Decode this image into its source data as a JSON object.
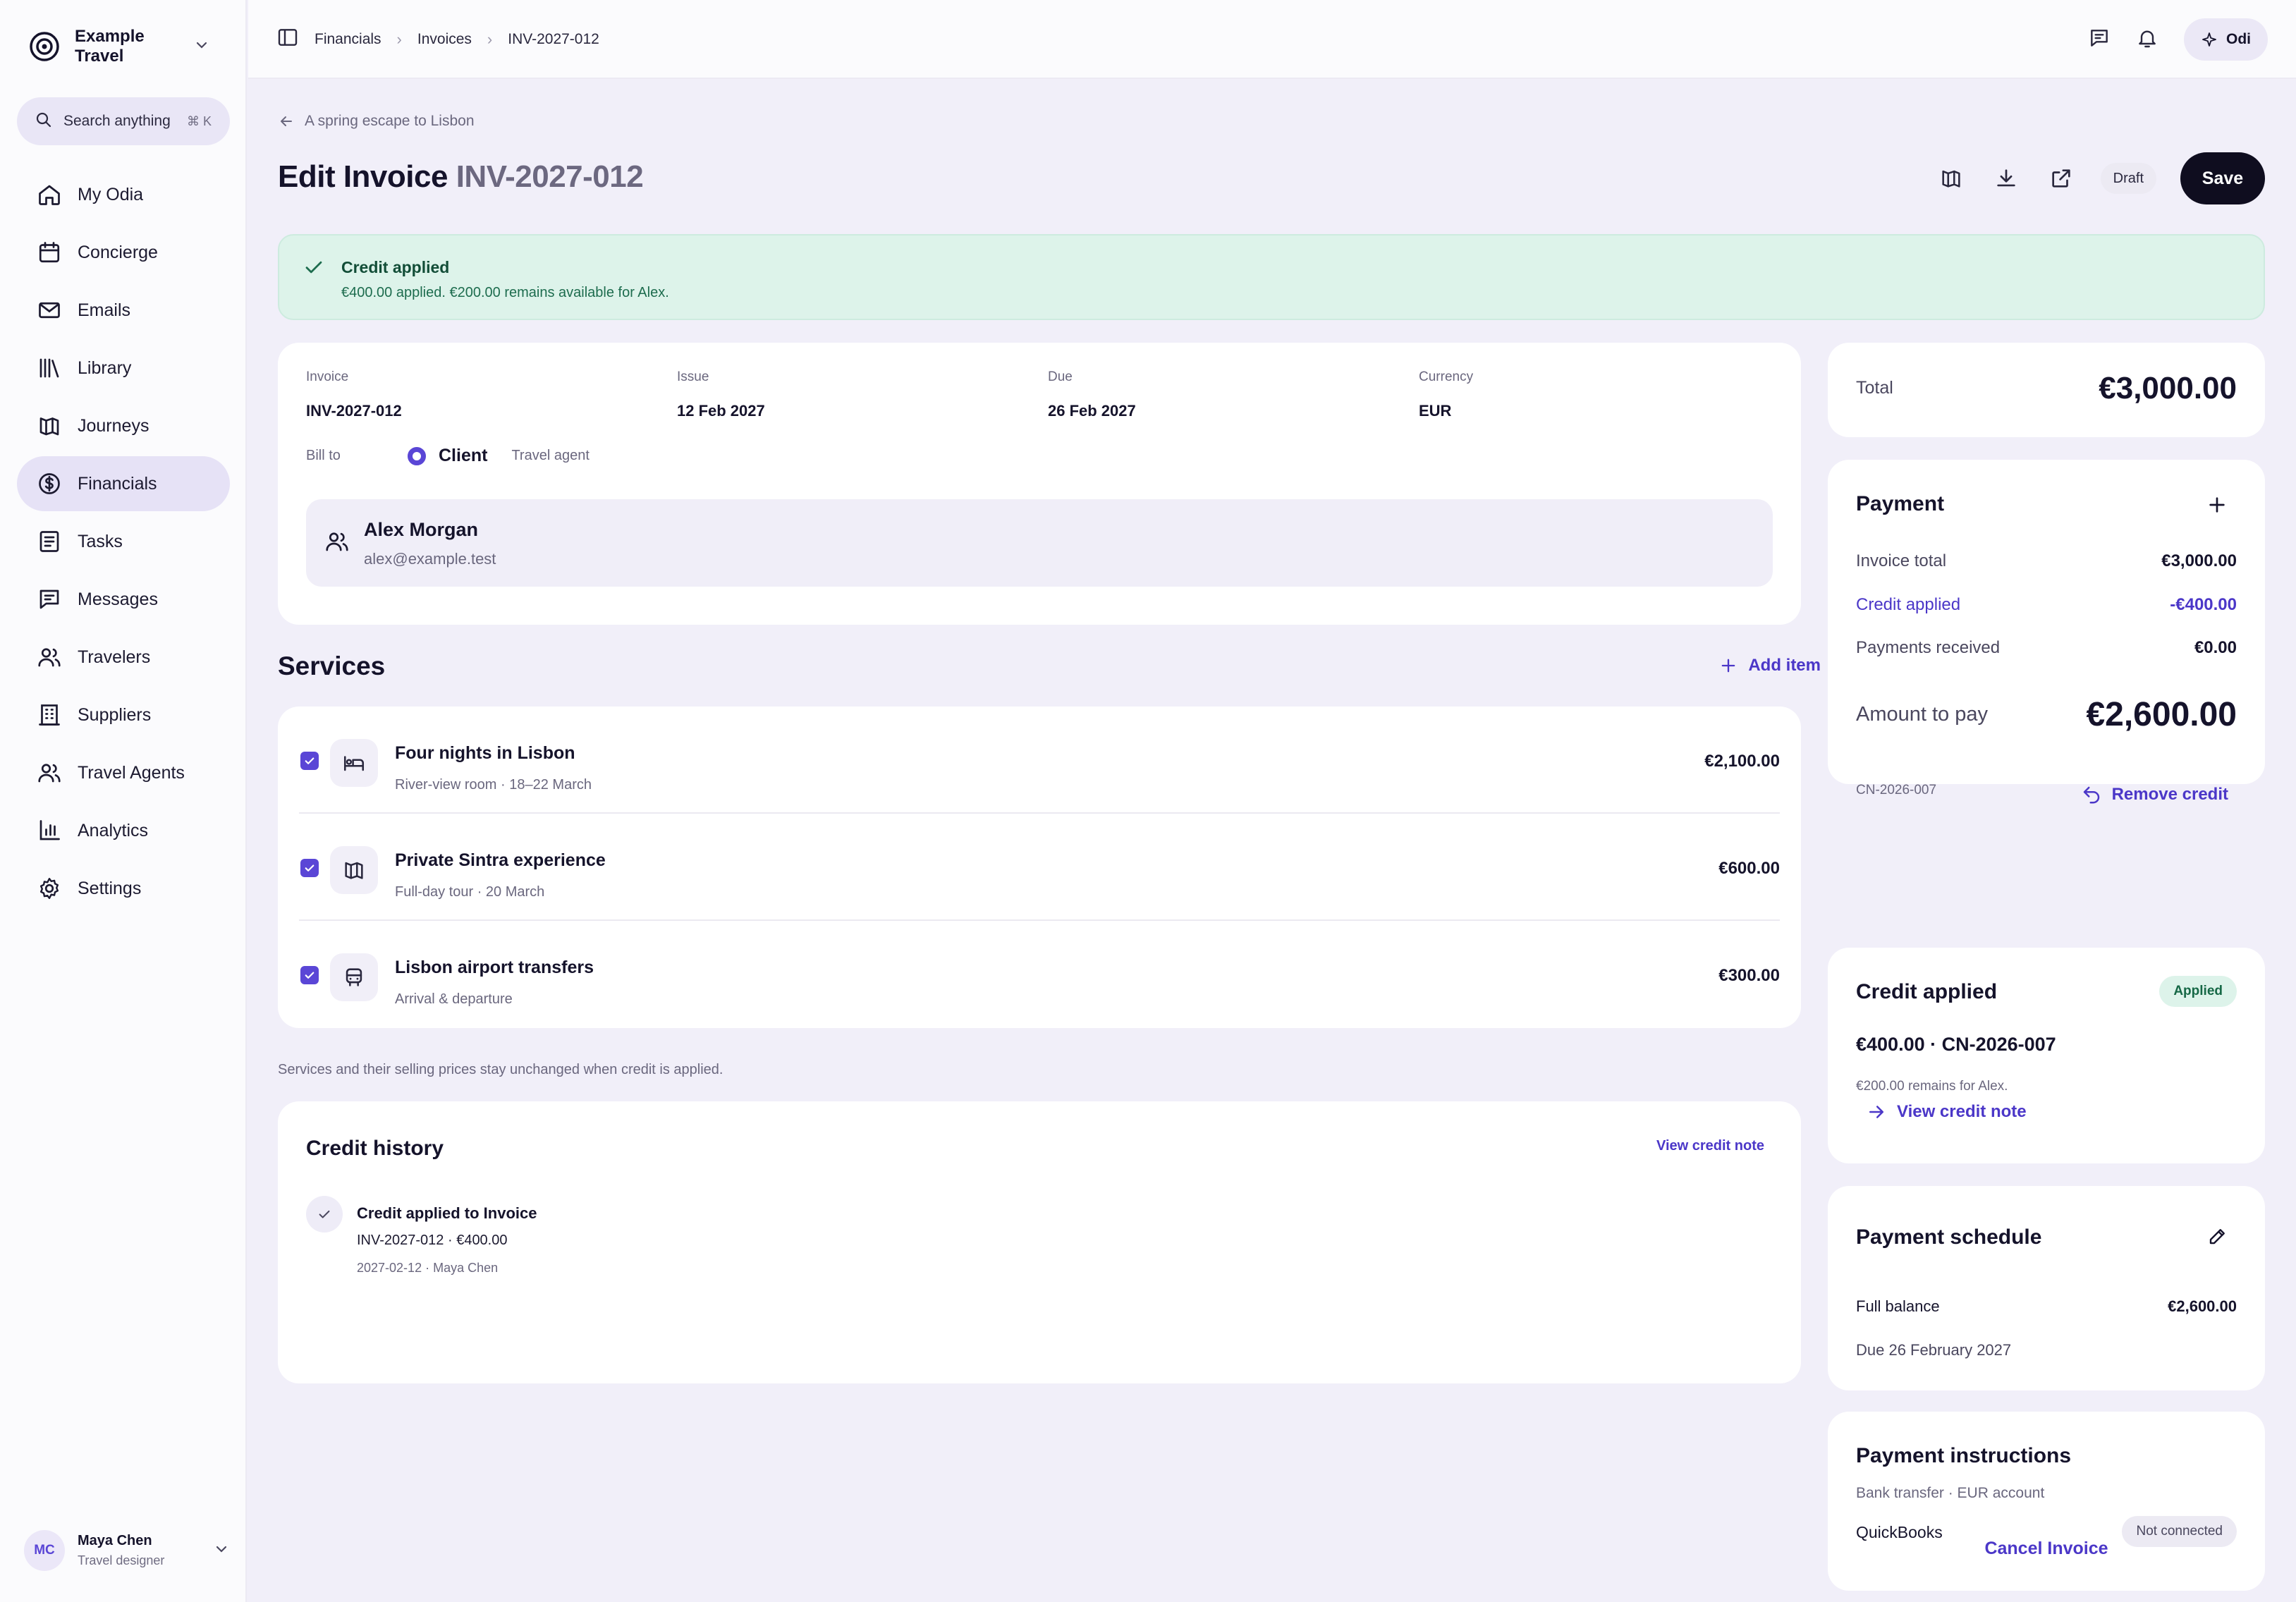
{
  "sidebar": {
    "workspace": "Example Travel",
    "search_placeholder": "Search anything",
    "search_shortcut": "⌘ K",
    "items": [
      {
        "label": "My Odia",
        "icon": "home-icon"
      },
      {
        "label": "Concierge",
        "icon": "calendar-icon"
      },
      {
        "label": "Emails",
        "icon": "mail-icon"
      },
      {
        "label": "Library",
        "icon": "library-icon"
      },
      {
        "label": "Journeys",
        "icon": "map-icon"
      },
      {
        "label": "Financials",
        "icon": "dollar-icon",
        "active": true
      },
      {
        "label": "Tasks",
        "icon": "tasks-icon"
      },
      {
        "label": "Messages",
        "icon": "message-icon"
      },
      {
        "label": "Travelers",
        "icon": "users-icon"
      },
      {
        "label": "Suppliers",
        "icon": "building-icon"
      },
      {
        "label": "Travel Agents",
        "icon": "users-icon"
      },
      {
        "label": "Analytics",
        "icon": "chart-icon"
      },
      {
        "label": "Settings",
        "icon": "gear-icon"
      }
    ],
    "user": {
      "initials": "MC",
      "name": "Maya Chen",
      "role": "Travel designer"
    }
  },
  "topbar": {
    "breadcrumbs": [
      "Financials",
      "Invoices",
      "INV-2027-012"
    ],
    "assistant_label": "Odi"
  },
  "header": {
    "back_label": "A spring escape to Lisbon",
    "title_prefix": "Edit Invoice",
    "title_number": "INV-2027-012",
    "status": "Draft",
    "save_label": "Save"
  },
  "alert": {
    "title": "Credit applied",
    "text": "€400.00 applied. €200.00 remains available for Alex."
  },
  "invoice": {
    "fields": [
      {
        "label": "Invoice",
        "value": "INV-2027-012"
      },
      {
        "label": "Issue",
        "value": "12 Feb 2027"
      },
      {
        "label": "Due",
        "value": "26 Feb 2027"
      },
      {
        "label": "Currency",
        "value": "EUR"
      }
    ],
    "bill_to_label": "Bill to",
    "bill_to_client": "Client",
    "bill_to_agent": "Travel agent",
    "client_name": "Alex Morgan",
    "client_email": "alex@example.test"
  },
  "services": {
    "title": "Services",
    "add_label": "Add item",
    "items": [
      {
        "name": "Four nights in Lisbon",
        "desc": "River-view room · 18–22 March",
        "price": "€2,100.00",
        "icon": "bed-icon"
      },
      {
        "name": "Private Sintra experience",
        "desc": "Full-day tour · 20 March",
        "price": "€600.00",
        "icon": "map-icon"
      },
      {
        "name": "Lisbon airport transfers",
        "desc": "Arrival & departure",
        "price": "€300.00",
        "icon": "car-icon"
      }
    ],
    "note": "Services and their selling prices stay unchanged when credit is applied."
  },
  "history": {
    "title": "Credit history",
    "link": "View credit note",
    "entry_title": "Credit applied to Invoice",
    "entry_sub": "INV-2027-012 · €400.00",
    "entry_meta": "2027-02-12 · Maya Chen"
  },
  "total": {
    "label": "Total",
    "value": "€3,000.00"
  },
  "payment": {
    "title": "Payment",
    "rows": [
      {
        "label": "Invoice total",
        "value": "€3,000.00"
      },
      {
        "label": "Credit applied",
        "value": "-€400.00"
      },
      {
        "label": "Payments received",
        "value": "€0.00"
      }
    ],
    "amount_label": "Amount to pay",
    "amount_value": "€2,600.00",
    "credit_ref": "CN-2026-007",
    "remove_label": "Remove credit"
  },
  "credit": {
    "title": "Credit applied",
    "badge": "Applied",
    "amount": "€400.00 · CN-2026-007",
    "remain": "€200.00 remains for Alex.",
    "link": "View credit note"
  },
  "schedule": {
    "title": "Payment schedule",
    "row_label": "Full balance",
    "row_value": "€2,600.00",
    "due": "Due 26 February 2027"
  },
  "instructions": {
    "title": "Payment instructions",
    "sub": "Bank transfer · EUR account",
    "integration": "QuickBooks",
    "integration_status": "Not connected"
  },
  "cancel_label": "Cancel Invoice",
  "colors": {
    "accent": "#5a46d6",
    "link": "#4b37c8",
    "success_bg": "#ddf3ea",
    "dark": "#0f0d1f"
  }
}
